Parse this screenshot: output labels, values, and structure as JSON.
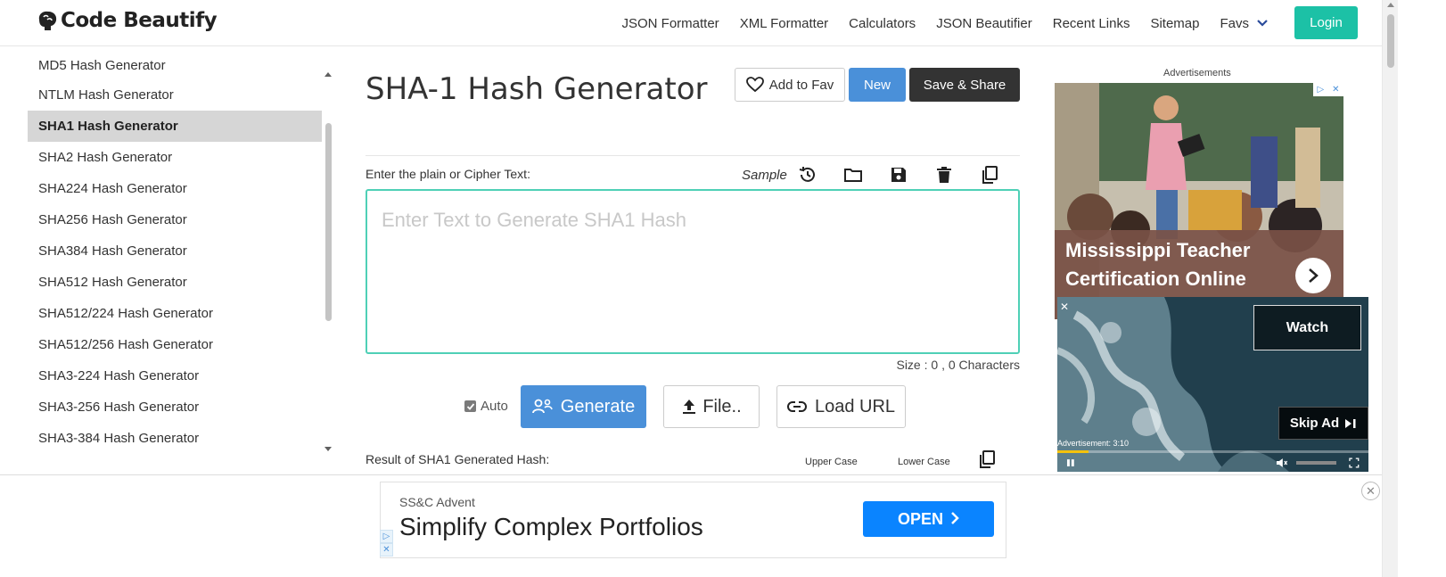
{
  "header": {
    "brand": "Code Beautify",
    "nav": [
      "JSON Formatter",
      "XML Formatter",
      "Calculators",
      "JSON Beautifier",
      "Recent Links",
      "Sitemap"
    ],
    "favs_label": "Favs",
    "login_label": "Login"
  },
  "sidebar": {
    "items": [
      "MD5 Hash Generator",
      "NTLM Hash Generator",
      "SHA1 Hash Generator",
      "SHA2 Hash Generator",
      "SHA224 Hash Generator",
      "SHA256 Hash Generator",
      "SHA384 Hash Generator",
      "SHA512 Hash Generator",
      "SHA512/224 Hash Generator",
      "SHA512/256 Hash Generator",
      "SHA3-224 Hash Generator",
      "SHA3-256 Hash Generator",
      "SHA3-384 Hash Generator"
    ],
    "active_index": 2
  },
  "main": {
    "title": "SHA-1 Hash Generator",
    "add_fav_label": "Add to Fav",
    "new_label": "New",
    "save_share_label": "Save & Share",
    "input_label": "Enter the plain or Cipher Text:",
    "sample_label": "Sample",
    "textarea_placeholder": "Enter Text to Generate SHA1 Hash",
    "textarea_value": "",
    "size_text": "Size : 0 , 0 Characters",
    "auto_label": "Auto",
    "auto_checked": true,
    "generate_label": "Generate",
    "file_label": "File..",
    "load_url_label": "Load URL",
    "result_label": "Result of SHA1 Generated Hash:",
    "upper_case_label": "Upper Case",
    "lower_case_label": "Lower Case"
  },
  "ads": {
    "caption": "Advertisements",
    "side_headline": "Mississippi Teacher Certification Online",
    "video_watch": "Watch",
    "video_skip": "Skip Ad",
    "video_counter": "Advertisement: 3:10",
    "video_progress": 0.1,
    "bottom_brand": "SS&C Advent",
    "bottom_headline": "Simplify Complex Portfolios",
    "bottom_cta": "OPEN"
  },
  "colors": {
    "accent": "#4a90d9",
    "login": "#1cc1a6",
    "textarea_border": "#4fd0b6",
    "dark_button": "#333333",
    "cta_blue": "#0a84ff"
  }
}
